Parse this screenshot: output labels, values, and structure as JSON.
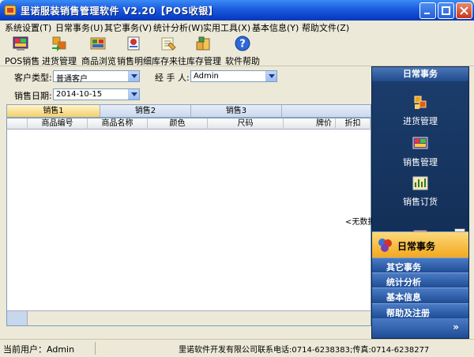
{
  "window": {
    "title": "里诺服装销售管理软件 V2.20【POS收银】"
  },
  "menu": [
    {
      "label": "系统设置(T)"
    },
    {
      "label": "日常事务(U)"
    },
    {
      "label": "其它事务(V)"
    },
    {
      "label": "统计分析(W)"
    },
    {
      "label": "实用工具(X)"
    },
    {
      "label": "基本信息(Y)"
    },
    {
      "label": "帮助文件(Z)"
    }
  ],
  "toolbar": [
    {
      "label": "POS销售",
      "icon": "pos-sales-icon"
    },
    {
      "label": "进货管理",
      "icon": "purchase-icon"
    },
    {
      "label": "商品浏览",
      "icon": "browse-icon"
    },
    {
      "label": "销售明细",
      "icon": "sales-detail-icon"
    },
    {
      "label": "库存来往",
      "icon": "stock-flow-icon"
    },
    {
      "label": "库存管理",
      "icon": "stock-manage-icon"
    },
    {
      "label": "软件帮助",
      "icon": "help-icon"
    }
  ],
  "form": {
    "customer_type_label": "客户类型:",
    "customer_type_value": "普通客户",
    "handler_label": "经 手 人:",
    "handler_value": "Admin",
    "sale_date_label": "销售日期:",
    "sale_date_value": "2014-10-15"
  },
  "tabs": [
    {
      "label": "销售1",
      "active": true
    },
    {
      "label": "销售2",
      "active": false
    },
    {
      "label": "销售3",
      "active": false
    }
  ],
  "grid": {
    "columns": [
      "商品编号",
      "商品名称",
      "颜色",
      "尺码",
      "牌价",
      "折扣"
    ],
    "empty_text": "<无数据"
  },
  "right_panel": {
    "header": "日常事务",
    "items": [
      {
        "label": "进货管理",
        "icon": "purchase-icon"
      },
      {
        "label": "销售管理",
        "icon": "sales-manage-icon"
      },
      {
        "label": "销售订货",
        "icon": "sales-order-icon"
      }
    ],
    "categories": [
      {
        "label": "日常事务",
        "active": true
      },
      {
        "label": "其它事务",
        "active": false
      },
      {
        "label": "统计分析",
        "active": false
      },
      {
        "label": "基本信息",
        "active": false
      },
      {
        "label": "帮助及注册",
        "active": false
      }
    ],
    "more": "»"
  },
  "status": {
    "user": "当前用户：Admin",
    "company": "里诺软件开发有限公司联系电话:0714-6238383;传真:0714-6238277"
  },
  "colors": {
    "titlebar": "#0a3fc7",
    "panel_bg": "#163564",
    "active_category": "#f3a81e",
    "active_tab": "#f5cf6a"
  }
}
